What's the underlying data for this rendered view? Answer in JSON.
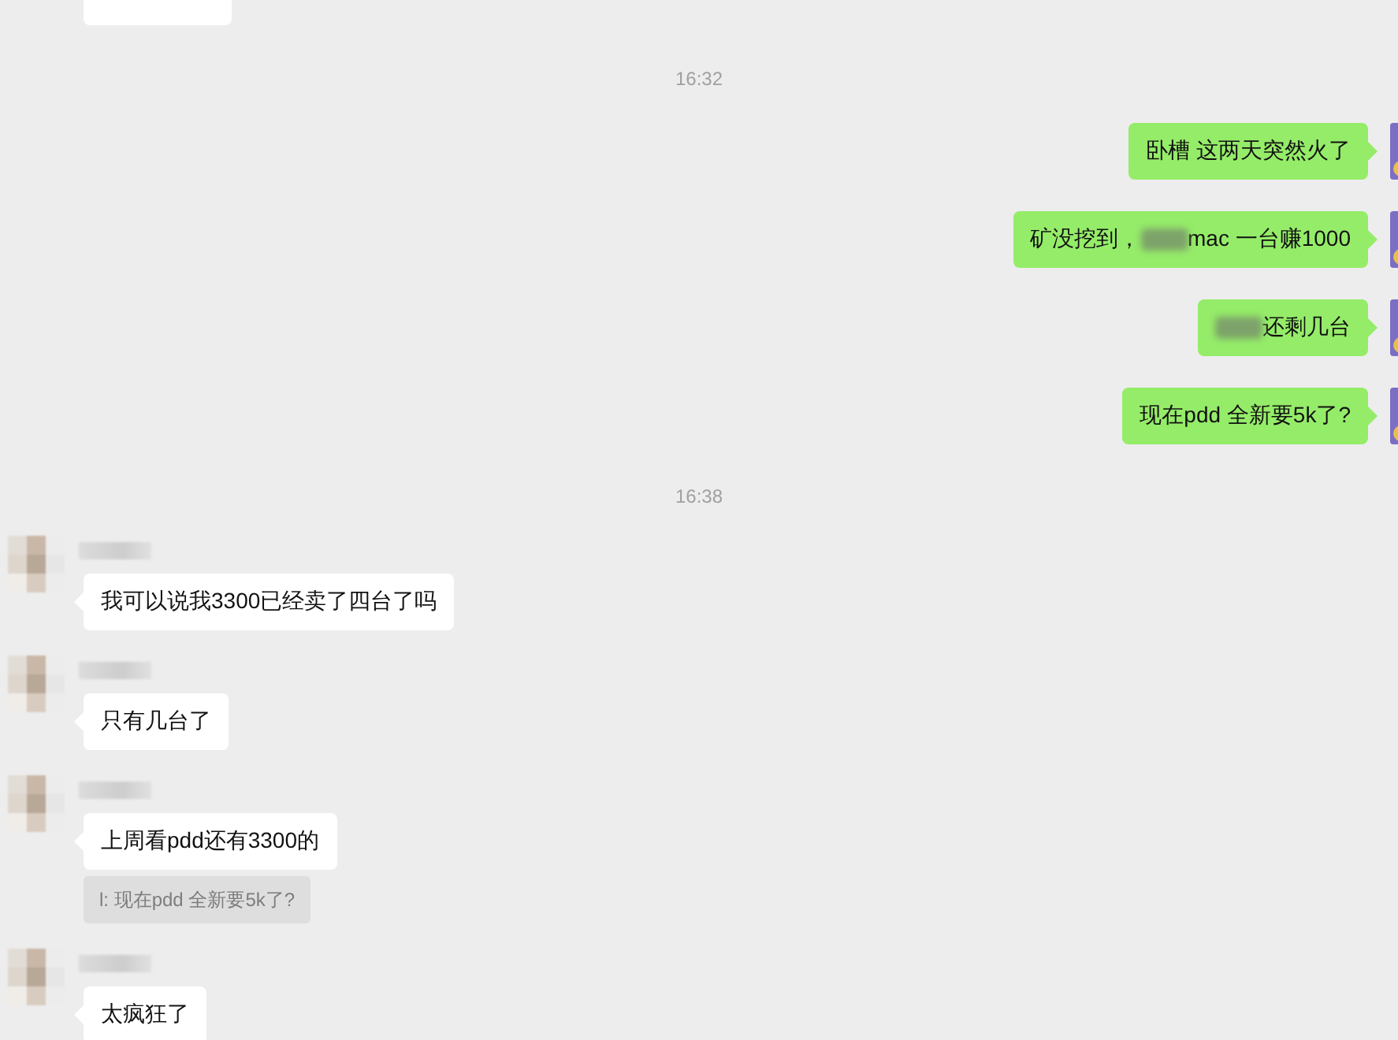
{
  "messages": [
    {
      "kind": "cut_incoming"
    },
    {
      "kind": "time",
      "text": "16:32"
    },
    {
      "kind": "outgoing",
      "segments": [
        {
          "kind": "text",
          "text": "卧槽 这两天突然火了"
        }
      ]
    },
    {
      "kind": "outgoing",
      "segments": [
        {
          "kind": "text",
          "text": "矿没挖到，"
        },
        {
          "kind": "redacted"
        },
        {
          "kind": "text",
          "text": "mac 一台赚1000"
        }
      ]
    },
    {
      "kind": "outgoing",
      "segments": [
        {
          "kind": "redacted"
        },
        {
          "kind": "text",
          "text": "还剩几台"
        }
      ]
    },
    {
      "kind": "outgoing",
      "segments": [
        {
          "kind": "text",
          "text": "现在pdd 全新要5k了?"
        }
      ]
    },
    {
      "kind": "time",
      "text": "16:38"
    },
    {
      "kind": "incoming",
      "segments": [
        {
          "kind": "text",
          "text": "我可以说我3300已经卖了四台了吗"
        }
      ]
    },
    {
      "kind": "incoming",
      "segments": [
        {
          "kind": "text",
          "text": "只有几台了"
        }
      ]
    },
    {
      "kind": "incoming",
      "segments": [
        {
          "kind": "text",
          "text": "上周看pdd还有3300的"
        }
      ],
      "quote": "l: 现在pdd 全新要5k了?"
    },
    {
      "kind": "incoming",
      "segments": [
        {
          "kind": "text",
          "text": "太疯狂了"
        }
      ]
    }
  ]
}
